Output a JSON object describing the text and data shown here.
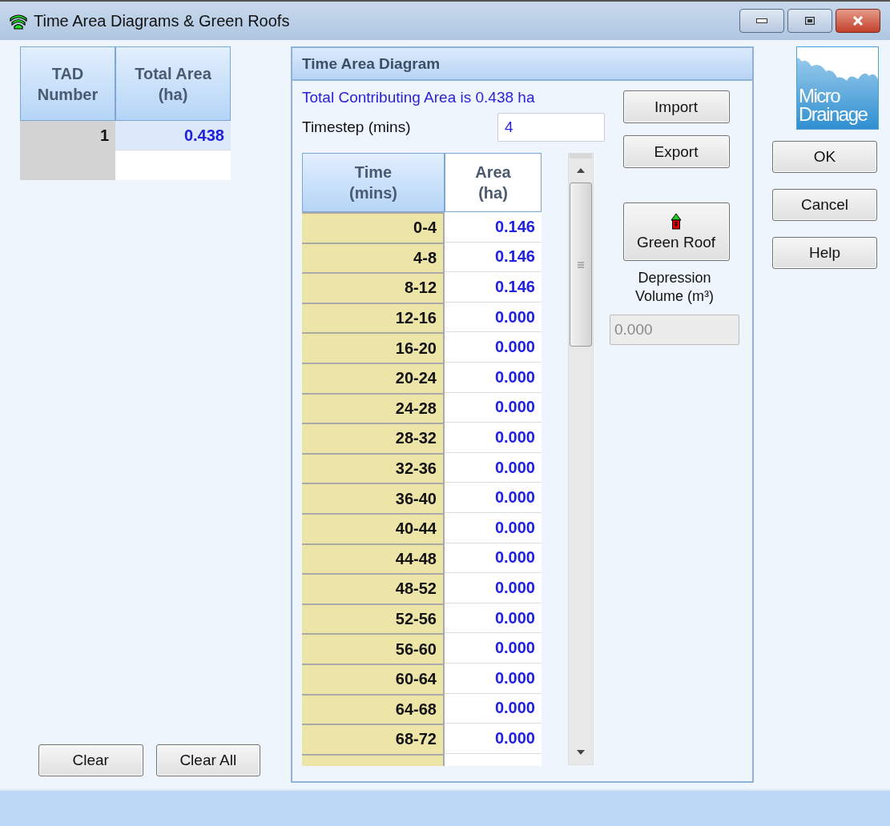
{
  "window": {
    "title": "Time Area Diagrams & Green Roofs"
  },
  "tad_table": {
    "columns": [
      "TAD Number",
      "Total Area (ha)"
    ],
    "rows": [
      {
        "tad_number": "1",
        "total_area": "0.438",
        "selected": true
      }
    ]
  },
  "left_buttons": [
    "Clear",
    "Clear All"
  ],
  "time_area_panel": {
    "title": "Time Area Diagram",
    "summary": "Total Contributing Area is 0.438 ha",
    "timestep": {
      "label": "Timestep (mins)",
      "value": "4"
    },
    "columns": [
      "Time (mins)",
      "Area (ha)"
    ],
    "rows": [
      {
        "time": "0-4",
        "area": "0.146"
      },
      {
        "time": "4-8",
        "area": "0.146"
      },
      {
        "time": "8-12",
        "area": "0.146"
      },
      {
        "time": "12-16",
        "area": "0.000"
      },
      {
        "time": "16-20",
        "area": "0.000"
      },
      {
        "time": "20-24",
        "area": "0.000"
      },
      {
        "time": "24-28",
        "area": "0.000"
      },
      {
        "time": "28-32",
        "area": "0.000"
      },
      {
        "time": "32-36",
        "area": "0.000"
      },
      {
        "time": "36-40",
        "area": "0.000"
      },
      {
        "time": "40-44",
        "area": "0.000"
      },
      {
        "time": "44-48",
        "area": "0.000"
      },
      {
        "time": "48-52",
        "area": "0.000"
      },
      {
        "time": "52-56",
        "area": "0.000"
      },
      {
        "time": "56-60",
        "area": "0.000"
      },
      {
        "time": "60-64",
        "area": "0.000"
      },
      {
        "time": "64-68",
        "area": "0.000"
      },
      {
        "time": "68-72",
        "area": "0.000"
      }
    ],
    "import_button": "Import",
    "export_button": "Export",
    "green_roof_button": "Green Roof",
    "depression_volume": {
      "label": "Depression Volume (m³)",
      "value": "0.000",
      "disabled": true
    }
  },
  "logo": {
    "lines": [
      "Micro",
      "Drainage"
    ]
  },
  "dialog_buttons": [
    "OK",
    "Cancel",
    "Help"
  ]
}
